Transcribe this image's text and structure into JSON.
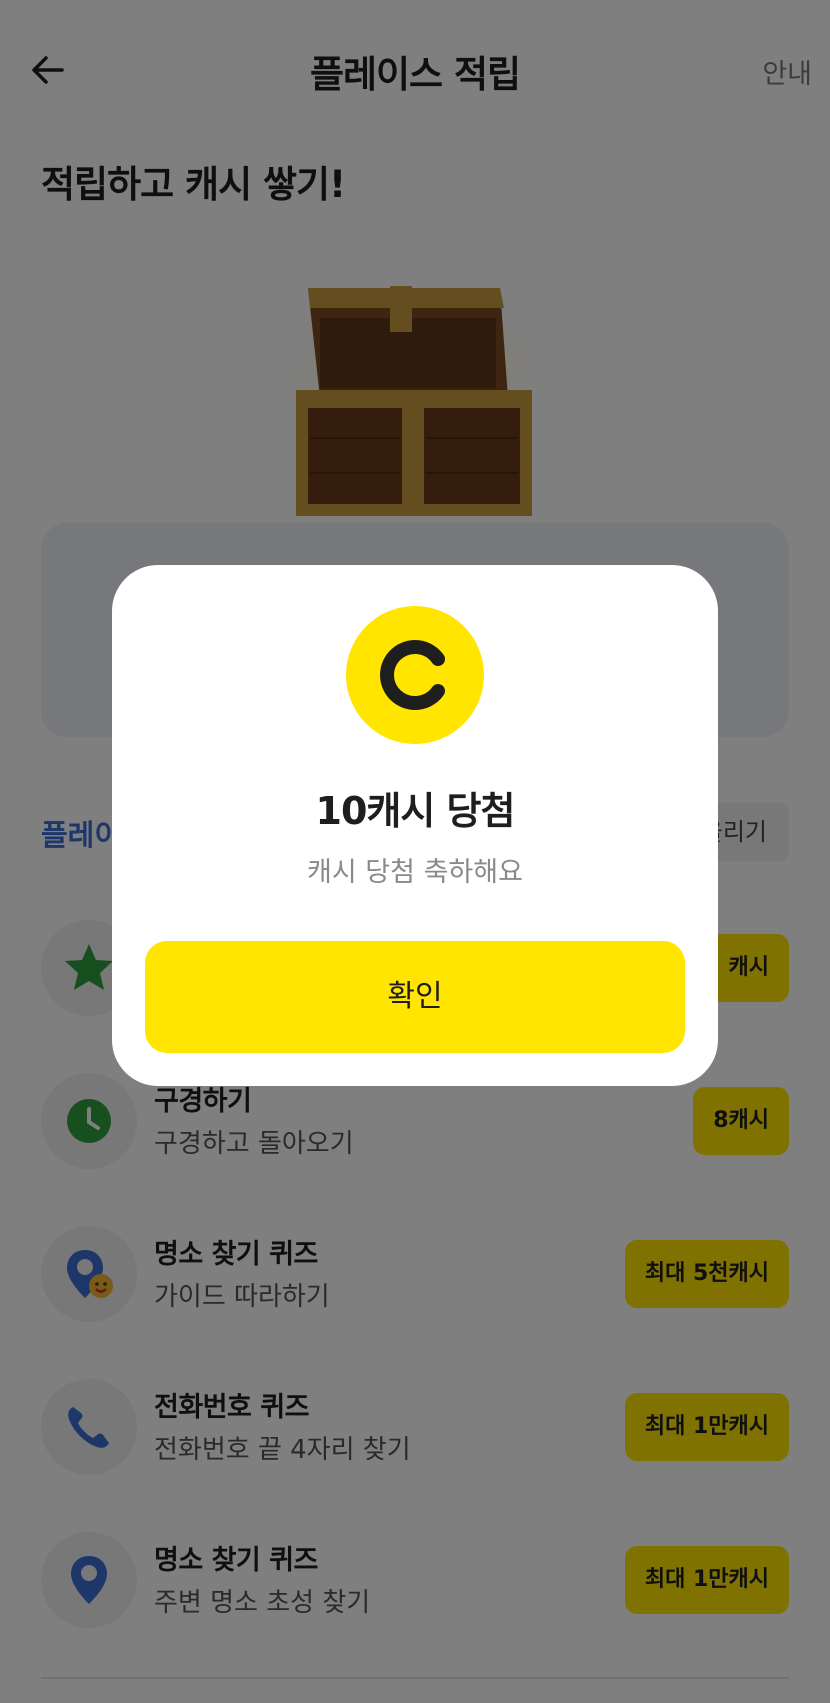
{
  "header": {
    "title": "플레이스 적립",
    "guide_label": "안내"
  },
  "headline": "적립하고 캐시 쌓기!",
  "section": {
    "title": "플레이",
    "button_label": "올리기"
  },
  "missions": [
    {
      "title": "",
      "subtitle": "",
      "reward": "캐시",
      "icon": "star-icon"
    },
    {
      "title": "구경하기",
      "subtitle": "구경하고 돌아오기",
      "reward": "8캐시",
      "icon": "clock-icon"
    },
    {
      "title": "명소 찾기 퀴즈",
      "subtitle": "가이드 따라하기",
      "reward": "최대 5천캐시",
      "icon": "location-emoji-icon"
    },
    {
      "title": "전화번호 퀴즈",
      "subtitle": "전화번호 끝 4자리 찾기",
      "reward": "최대 1만캐시",
      "icon": "phone-icon"
    },
    {
      "title": "명소 찾기 퀴즈",
      "subtitle": "주변 명소 초성 찾기",
      "reward": "최대 1만캐시",
      "icon": "location-pin-icon"
    }
  ],
  "modal": {
    "icon": "cash-coin-icon",
    "title": "10캐시 당첨",
    "subtitle": "캐시 당첨 축하해요",
    "confirm_label": "확인"
  },
  "colors": {
    "accent_yellow": "#ffe500",
    "section_blue": "#3b6fd4",
    "star_green": "#2e9e3e",
    "clock_green": "#2e9e3e",
    "icon_blue": "#3b6fd4",
    "overlay": "rgba(0,0,0,0.5)"
  }
}
